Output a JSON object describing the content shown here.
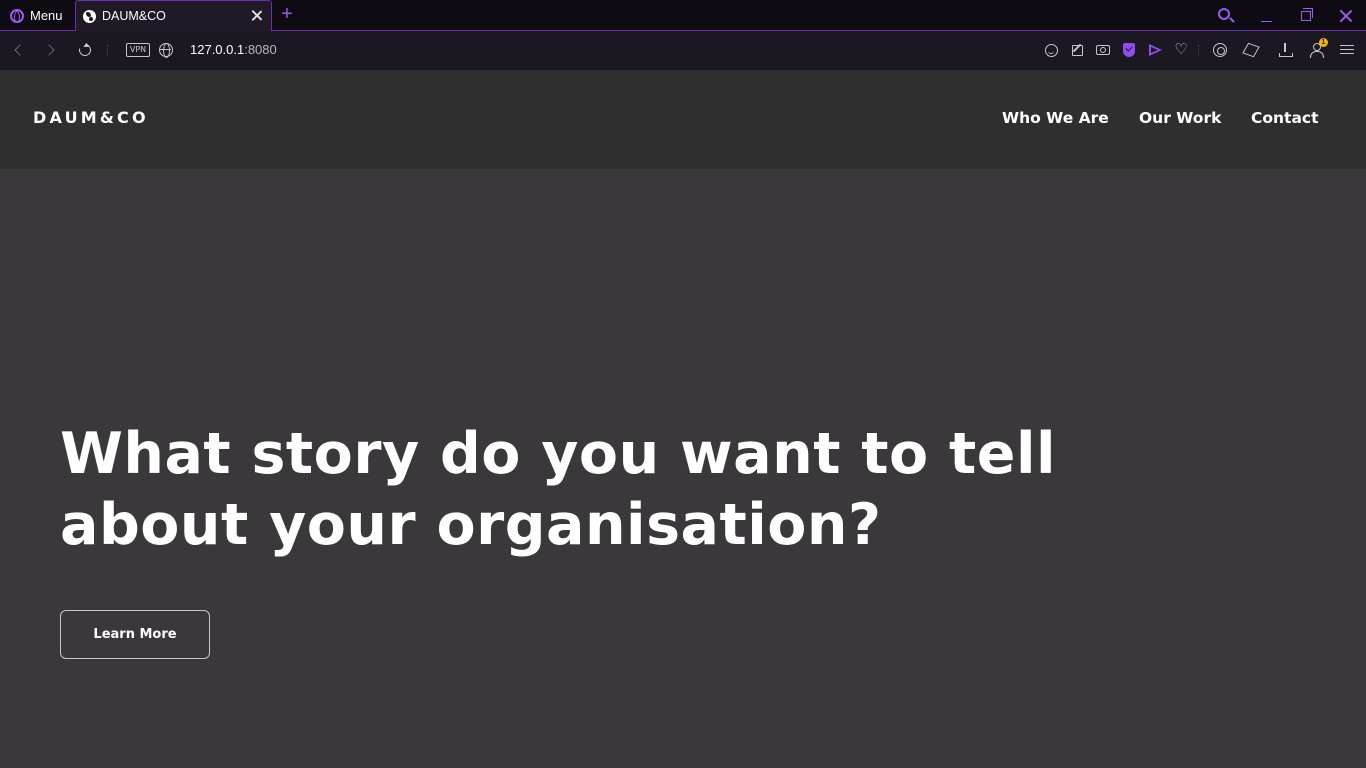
{
  "browser": {
    "menu_label": "Menu",
    "tab_title": "DAUM&CO",
    "new_tab_symbol": "+",
    "vpn_label": "VPN",
    "url_host": "127.0.0.1",
    "url_port": ":8080",
    "notification_count": "1",
    "accent_color": "#9a5cf0"
  },
  "site": {
    "logo": "DAUM&CO",
    "nav": [
      "Who We Are",
      "Our Work",
      "Contact"
    ],
    "hero": {
      "title_line1": "What story do you want to tell",
      "title_line2": "about your organisation?",
      "cta_label": "Learn More"
    },
    "colors": {
      "header_bg": "#2f2f2f",
      "hero_bg": "#3a383b",
      "text": "#ffffff"
    }
  }
}
